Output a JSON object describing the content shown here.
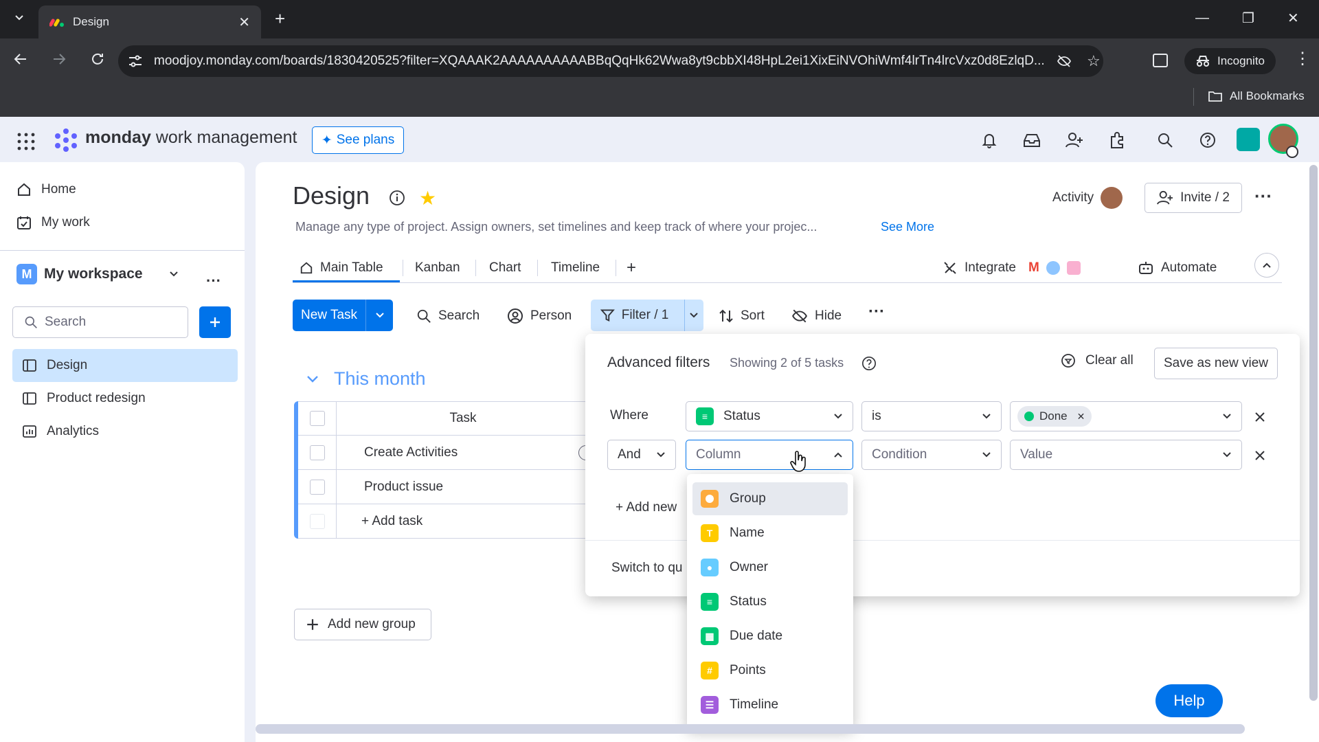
{
  "browser": {
    "tab_title": "Design",
    "url": "moodjoy.monday.com/boards/1830420525?filter=XQAAAK2AAAAAAAAAABBqQqHk62Wwa8yt9cbbXI48HpL2ei1XixEiNVOhiWmf4lrTn4lrcVxz0d8EzlqD...",
    "incognito_label": "Incognito",
    "bookmarks_label": "All Bookmarks"
  },
  "appbar": {
    "brand_bold": "monday",
    "brand_rest": "work management",
    "see_plans": "See plans"
  },
  "sidebar": {
    "home": "Home",
    "my_work": "My work",
    "workspace_name": "My workspace",
    "search_placeholder": "Search",
    "boards": [
      {
        "label": "Design",
        "active": true
      },
      {
        "label": "Product redesign",
        "active": false
      },
      {
        "label": "Analytics",
        "active": false
      }
    ]
  },
  "board": {
    "title": "Design",
    "description": "Manage any type of project. Assign owners, set timelines and keep track of where your projec...",
    "see_more": "See More",
    "activity": "Activity",
    "invite": "Invite / 2",
    "tabs": [
      "Main Table",
      "Kanban",
      "Chart",
      "Timeline"
    ],
    "integrate": "Integrate",
    "automate": "Automate",
    "toolbar": {
      "new_task": "New Task",
      "search": "Search",
      "person": "Person",
      "filter": "Filter / 1",
      "sort": "Sort",
      "hide": "Hide"
    },
    "group": {
      "title": "This month",
      "column_task": "Task",
      "rows": [
        "Create Activities",
        "Product issue"
      ],
      "add_task": "+ Add task"
    },
    "add_new_group": "Add new group"
  },
  "filter_panel": {
    "title": "Advanced filters",
    "showing": "Showing 2 of 5 tasks",
    "clear_all": "Clear all",
    "save_view": "Save as new view",
    "where": "Where",
    "rule1": {
      "column": "Status",
      "condition": "is",
      "value": "Done"
    },
    "rule2": {
      "conjunction": "And",
      "column": "Column",
      "condition": "Condition",
      "value": "Value"
    },
    "add_new": "+ Add new",
    "switch": "Switch to qu"
  },
  "column_menu": [
    {
      "label": "Group",
      "color": "#fdab3d",
      "icon": "group-icon"
    },
    {
      "label": "Name",
      "color": "#ffcb00",
      "icon": "text-icon"
    },
    {
      "label": "Owner",
      "color": "#66ccff",
      "icon": "person-icon"
    },
    {
      "label": "Status",
      "color": "#00c875",
      "icon": "status-icon"
    },
    {
      "label": "Due date",
      "color": "#00c875",
      "icon": "date-icon"
    },
    {
      "label": "Points",
      "color": "#ffcb00",
      "icon": "numbers-icon"
    },
    {
      "label": "Timeline",
      "color": "#a25ddc",
      "icon": "timeline-icon"
    }
  ],
  "help": "Help"
}
